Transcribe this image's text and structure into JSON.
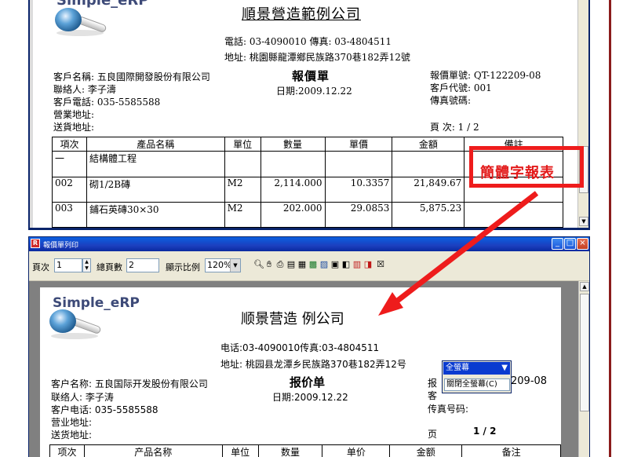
{
  "top_report": {
    "logo": "Simple_eRP",
    "company": "順景營造範例公司",
    "phone_fax": "電話: 03-4090010  傳真: 03-4804511",
    "address": "地址: 桃園縣龍潭鄉民族路370巷182弄12號",
    "doc_title": "報價單",
    "date": "日期:2009.12.22",
    "customer_name": "客戶名稱: 五良國際開發股份有限公司",
    "contact": "聯絡人: 李子濤",
    "customer_phone": "客戶電話: 035-5585588",
    "business_address": "營業地址:",
    "delivery_address": "送貨地址:",
    "quote_no": "報價單號: QT-122209-08",
    "customer_code": "客戶代號: 001",
    "fax_no": "傳真號碼:",
    "page": "頁    次: 1 / 2",
    "columns": [
      "項次",
      "產品名稱",
      "單位",
      "數量",
      "單價",
      "金額",
      "備註"
    ],
    "rows": [
      {
        "no": "一",
        "name": "結構體工程",
        "unit": "",
        "qty": "",
        "price": "",
        "amount": "",
        "note": ""
      },
      {
        "no": "002",
        "name": "砌1/2B磚",
        "unit": "M2",
        "qty": "2,114.000",
        "price": "10.3357",
        "amount": "21,849.67",
        "note": ""
      },
      {
        "no": "003",
        "name": "鋪石英磚30×30",
        "unit": "M2",
        "qty": "202.000",
        "price": "29.0853",
        "amount": "5,875.23",
        "note": ""
      }
    ]
  },
  "annotation": {
    "label": "簡體字報表",
    "color": "#ee1c1c"
  },
  "preview_window": {
    "title": "報價單列印",
    "controls": {
      "minimize": "_",
      "maximize": "□",
      "close": "×"
    },
    "toolbar": {
      "page_label": "頁次",
      "page_value": "1",
      "total_label": "總頁數",
      "total_value": "2",
      "zoom_label": "顯示比例",
      "zoom_value": "120%"
    },
    "toolbar_icons": [
      "zoom-icon",
      "hand-icon",
      "print-icon",
      "page-setup-icon",
      "export-icon",
      "excel-icon",
      "word-icon",
      "save-icon",
      "pdf-icon",
      "mail-icon",
      "close-preview-icon"
    ],
    "report": {
      "logo": "Simple_eRP",
      "company": "顺景营造  例公司",
      "phone_fax": "电话:03-4090010传真:03-4804511",
      "address": "地址: 桃园县龙潭乡民族路370巷182弄12号",
      "doc_title": "报价单",
      "date": "日期:2009.12.22",
      "customer_name": "客户名称: 五良国际开发股份有限公司",
      "contact": "联络人: 李子涛",
      "customer_phone": "客户电话: 035-5585588",
      "business_address": "营业地址:",
      "delivery_address": "送货地址:",
      "quote_no_partial": "报",
      "quote_no_tail": "209-08",
      "code_partial": "客",
      "fax_no": "传真号码:",
      "page_label": "页",
      "page_value": "1 / 2",
      "columns": [
        "项次",
        "产品名称",
        "单位",
        "数量",
        "单价",
        "金额",
        "备注"
      ]
    },
    "popup": {
      "header": "全螢幕",
      "item": "關閉全螢幕(C)"
    }
  }
}
